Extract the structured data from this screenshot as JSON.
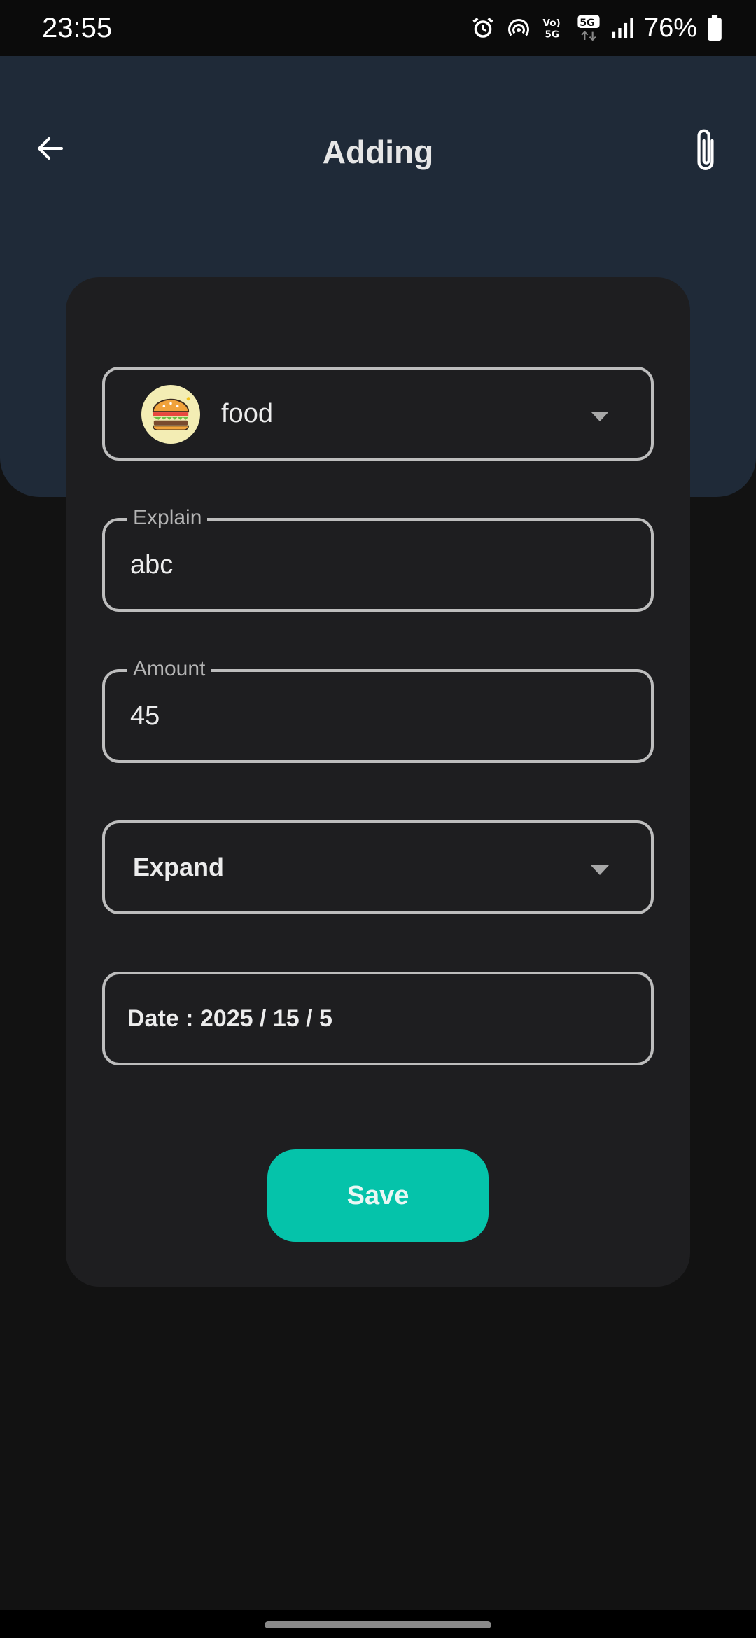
{
  "status_bar": {
    "time": "23:55",
    "battery": "76%",
    "icons": [
      "alarm-icon",
      "hotspot-icon",
      "volte-5g-icon",
      "5g-data-icon",
      "signal-icon",
      "battery-icon"
    ]
  },
  "header": {
    "title": "Adding",
    "back_icon": "arrow-left-icon",
    "attach_icon": "paperclip-icon",
    "background_color": "#1F2A38"
  },
  "form": {
    "category": {
      "label": "food",
      "icon": "burger-icon"
    },
    "explain": {
      "label": "Explain",
      "value": "abc"
    },
    "amount": {
      "label": "Amount",
      "value": "45"
    },
    "type": {
      "value": "Expand"
    },
    "date": {
      "text": "Date : 2025 / 15 / 5"
    },
    "save_label": "Save"
  },
  "colors": {
    "accent": "#05C3AA",
    "card": "#1E1E20",
    "background": "#121212"
  }
}
